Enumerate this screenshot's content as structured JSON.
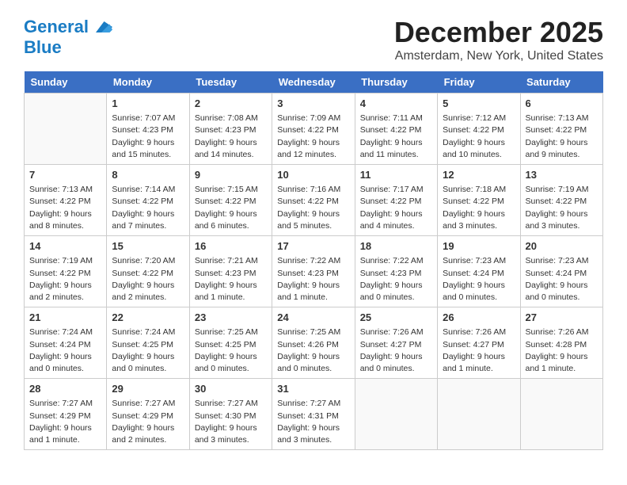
{
  "logo": {
    "line1": "General",
    "line2": "Blue"
  },
  "title": "December 2025",
  "subtitle": "Amsterdam, New York, United States",
  "days_of_week": [
    "Sunday",
    "Monday",
    "Tuesday",
    "Wednesday",
    "Thursday",
    "Friday",
    "Saturday"
  ],
  "weeks": [
    [
      {
        "num": "",
        "info": ""
      },
      {
        "num": "1",
        "info": "Sunrise: 7:07 AM\nSunset: 4:23 PM\nDaylight: 9 hours\nand 15 minutes."
      },
      {
        "num": "2",
        "info": "Sunrise: 7:08 AM\nSunset: 4:23 PM\nDaylight: 9 hours\nand 14 minutes."
      },
      {
        "num": "3",
        "info": "Sunrise: 7:09 AM\nSunset: 4:22 PM\nDaylight: 9 hours\nand 12 minutes."
      },
      {
        "num": "4",
        "info": "Sunrise: 7:11 AM\nSunset: 4:22 PM\nDaylight: 9 hours\nand 11 minutes."
      },
      {
        "num": "5",
        "info": "Sunrise: 7:12 AM\nSunset: 4:22 PM\nDaylight: 9 hours\nand 10 minutes."
      },
      {
        "num": "6",
        "info": "Sunrise: 7:13 AM\nSunset: 4:22 PM\nDaylight: 9 hours\nand 9 minutes."
      }
    ],
    [
      {
        "num": "7",
        "info": "Sunrise: 7:13 AM\nSunset: 4:22 PM\nDaylight: 9 hours\nand 8 minutes."
      },
      {
        "num": "8",
        "info": "Sunrise: 7:14 AM\nSunset: 4:22 PM\nDaylight: 9 hours\nand 7 minutes."
      },
      {
        "num": "9",
        "info": "Sunrise: 7:15 AM\nSunset: 4:22 PM\nDaylight: 9 hours\nand 6 minutes."
      },
      {
        "num": "10",
        "info": "Sunrise: 7:16 AM\nSunset: 4:22 PM\nDaylight: 9 hours\nand 5 minutes."
      },
      {
        "num": "11",
        "info": "Sunrise: 7:17 AM\nSunset: 4:22 PM\nDaylight: 9 hours\nand 4 minutes."
      },
      {
        "num": "12",
        "info": "Sunrise: 7:18 AM\nSunset: 4:22 PM\nDaylight: 9 hours\nand 3 minutes."
      },
      {
        "num": "13",
        "info": "Sunrise: 7:19 AM\nSunset: 4:22 PM\nDaylight: 9 hours\nand 3 minutes."
      }
    ],
    [
      {
        "num": "14",
        "info": "Sunrise: 7:19 AM\nSunset: 4:22 PM\nDaylight: 9 hours\nand 2 minutes."
      },
      {
        "num": "15",
        "info": "Sunrise: 7:20 AM\nSunset: 4:22 PM\nDaylight: 9 hours\nand 2 minutes."
      },
      {
        "num": "16",
        "info": "Sunrise: 7:21 AM\nSunset: 4:23 PM\nDaylight: 9 hours\nand 1 minute."
      },
      {
        "num": "17",
        "info": "Sunrise: 7:22 AM\nSunset: 4:23 PM\nDaylight: 9 hours\nand 1 minute."
      },
      {
        "num": "18",
        "info": "Sunrise: 7:22 AM\nSunset: 4:23 PM\nDaylight: 9 hours\nand 0 minutes."
      },
      {
        "num": "19",
        "info": "Sunrise: 7:23 AM\nSunset: 4:24 PM\nDaylight: 9 hours\nand 0 minutes."
      },
      {
        "num": "20",
        "info": "Sunrise: 7:23 AM\nSunset: 4:24 PM\nDaylight: 9 hours\nand 0 minutes."
      }
    ],
    [
      {
        "num": "21",
        "info": "Sunrise: 7:24 AM\nSunset: 4:24 PM\nDaylight: 9 hours\nand 0 minutes."
      },
      {
        "num": "22",
        "info": "Sunrise: 7:24 AM\nSunset: 4:25 PM\nDaylight: 9 hours\nand 0 minutes."
      },
      {
        "num": "23",
        "info": "Sunrise: 7:25 AM\nSunset: 4:25 PM\nDaylight: 9 hours\nand 0 minutes."
      },
      {
        "num": "24",
        "info": "Sunrise: 7:25 AM\nSunset: 4:26 PM\nDaylight: 9 hours\nand 0 minutes."
      },
      {
        "num": "25",
        "info": "Sunrise: 7:26 AM\nSunset: 4:27 PM\nDaylight: 9 hours\nand 0 minutes."
      },
      {
        "num": "26",
        "info": "Sunrise: 7:26 AM\nSunset: 4:27 PM\nDaylight: 9 hours\nand 1 minute."
      },
      {
        "num": "27",
        "info": "Sunrise: 7:26 AM\nSunset: 4:28 PM\nDaylight: 9 hours\nand 1 minute."
      }
    ],
    [
      {
        "num": "28",
        "info": "Sunrise: 7:27 AM\nSunset: 4:29 PM\nDaylight: 9 hours\nand 1 minute."
      },
      {
        "num": "29",
        "info": "Sunrise: 7:27 AM\nSunset: 4:29 PM\nDaylight: 9 hours\nand 2 minutes."
      },
      {
        "num": "30",
        "info": "Sunrise: 7:27 AM\nSunset: 4:30 PM\nDaylight: 9 hours\nand 3 minutes."
      },
      {
        "num": "31",
        "info": "Sunrise: 7:27 AM\nSunset: 4:31 PM\nDaylight: 9 hours\nand 3 minutes."
      },
      {
        "num": "",
        "info": ""
      },
      {
        "num": "",
        "info": ""
      },
      {
        "num": "",
        "info": ""
      }
    ]
  ]
}
